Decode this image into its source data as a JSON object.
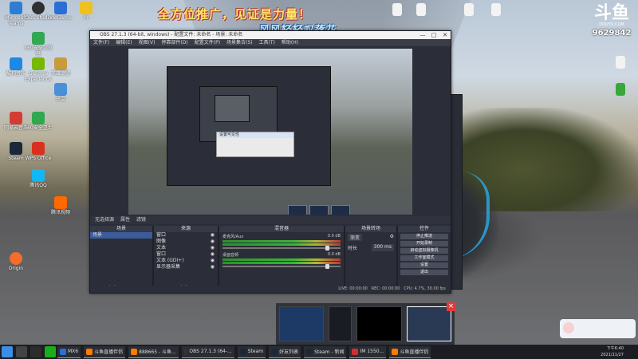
{
  "banner": {
    "line1": "全方位推广，见证是力量！",
    "line2": "风风轻轻叹落花"
  },
  "douyu": {
    "logo": "斗鱼",
    "sub": "DOUYU.COM",
    "room_id": "9629842"
  },
  "desktop_icons": [
    {
      "label": "Microsoft Teams",
      "color": "#2d7dd2"
    },
    {
      "label": "OBS Studio",
      "color": "#303030"
    },
    {
      "label": "WeGame",
      "color": "#2b6fd6"
    },
    {
      "label": "YY",
      "color": "#f0c020"
    },
    {
      "label": "360安全浏览器",
      "color": "#33a852"
    },
    {
      "label": "GeForce Experience",
      "color": "#76b900"
    },
    {
      "label": "英雄联盟",
      "color": "#c89b3c"
    },
    {
      "label": "酷狗音乐",
      "color": "#1e88e5"
    },
    {
      "label": "迅雷",
      "color": "#4a90d9"
    },
    {
      "label": "网易云音乐",
      "color": "#d43c33"
    },
    {
      "label": "Steam",
      "color": "#1b2838"
    },
    {
      "label": "WPS Office",
      "color": "#d9301f"
    },
    {
      "label": "腾讯QQ",
      "color": "#12b7f5"
    },
    {
      "label": "360安全卫士",
      "color": "#2fa84f"
    },
    {
      "label": "腾讯视频",
      "color": "#ff6a00"
    },
    {
      "label": "Origin",
      "color": "#f56c2d"
    }
  ],
  "obs": {
    "title": "OBS 27.1.3 (64-bit, windows) - 配置文件: 未命名 - 场景: 未命名",
    "menu": [
      "文件(F)",
      "编辑(E)",
      "视图(V)",
      "停靠部件(D)",
      "配置文件(P)",
      "场景集合(S)",
      "工具(T)",
      "帮助(H)"
    ],
    "preview_popup": "设置可见性",
    "toolbar": [
      "无选择源",
      "属性",
      "滤镜"
    ],
    "docks": {
      "scenes": {
        "title": "场景",
        "items": [
          "场景"
        ]
      },
      "sources": {
        "title": "来源",
        "items": [
          "窗口",
          "图像",
          "文本",
          "窗口",
          "文本 (GDI+)",
          "显示器采集"
        ]
      },
      "mixer": {
        "title": "混音器",
        "channels": [
          {
            "name": "麦克风/Aux",
            "db": "0.0 dB"
          },
          {
            "name": "桌面音频",
            "db": "0.0 dB"
          }
        ]
      },
      "transitions": {
        "title": "场景转场",
        "type": "渐变",
        "duration_label": "时长",
        "duration": "300 ms"
      },
      "controls": {
        "title": "控件",
        "buttons": [
          "停止推流",
          "开始录制",
          "启动虚拟摄像机",
          "工作室模式",
          "设置",
          "退出"
        ]
      }
    },
    "status": {
      "live": "LIVE: 00:00:00",
      "rec": "REC: 00:00:00",
      "cpu": "CPU: 4.7%, 30.00 fps"
    }
  },
  "taskbar": {
    "tasks": [
      "MX6",
      "斗鱼直播伴侣",
      "888665 - 斗鱼...",
      "OBS 27.1.3 (64-...",
      "Steam",
      "好友列表",
      "Steam - 新闻",
      "IM 1550...",
      "斗鱼直播伴侣"
    ],
    "time": "下午6:40",
    "date": "2021/11/27"
  }
}
